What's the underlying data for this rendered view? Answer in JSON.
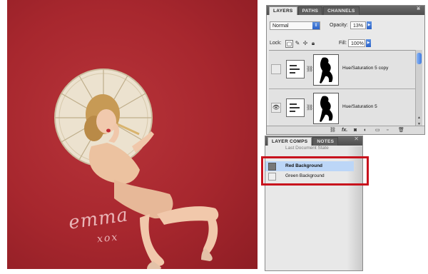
{
  "photo": {
    "signature_line1": "emma",
    "signature_line2": "xox"
  },
  "layers_panel": {
    "tabs": [
      "LAYERS",
      "PATHS",
      "CHANNELS"
    ],
    "blend_mode": "Normal",
    "opacity_label": "Opacity:",
    "opacity_value": "13%",
    "lock_label": "Lock:",
    "fill_label": "Fill:",
    "fill_value": "100%",
    "layers": [
      {
        "name": "Hue/Saturation 5 copy",
        "visible": false
      },
      {
        "name": "Hue/Saturation 5",
        "visible": true
      }
    ],
    "footer_icons": [
      "link-icon",
      "fx-icon",
      "mask-icon",
      "adjustment-icon",
      "folder-icon",
      "new-layer-icon",
      "trash-icon"
    ],
    "footer_fx": "fx."
  },
  "comps_panel": {
    "tabs": [
      "LAYER COMPS",
      "NOTES"
    ],
    "comps": [
      {
        "name": "Last Document State",
        "selected": false,
        "applied": false
      },
      {
        "name": "Red Background",
        "selected": true,
        "applied": true
      },
      {
        "name": "Green Background",
        "selected": false,
        "applied": false
      }
    ]
  },
  "colors": {
    "photo_background": "#a7272e",
    "highlight": "#c8121d",
    "selection": "#bcd6f7"
  }
}
